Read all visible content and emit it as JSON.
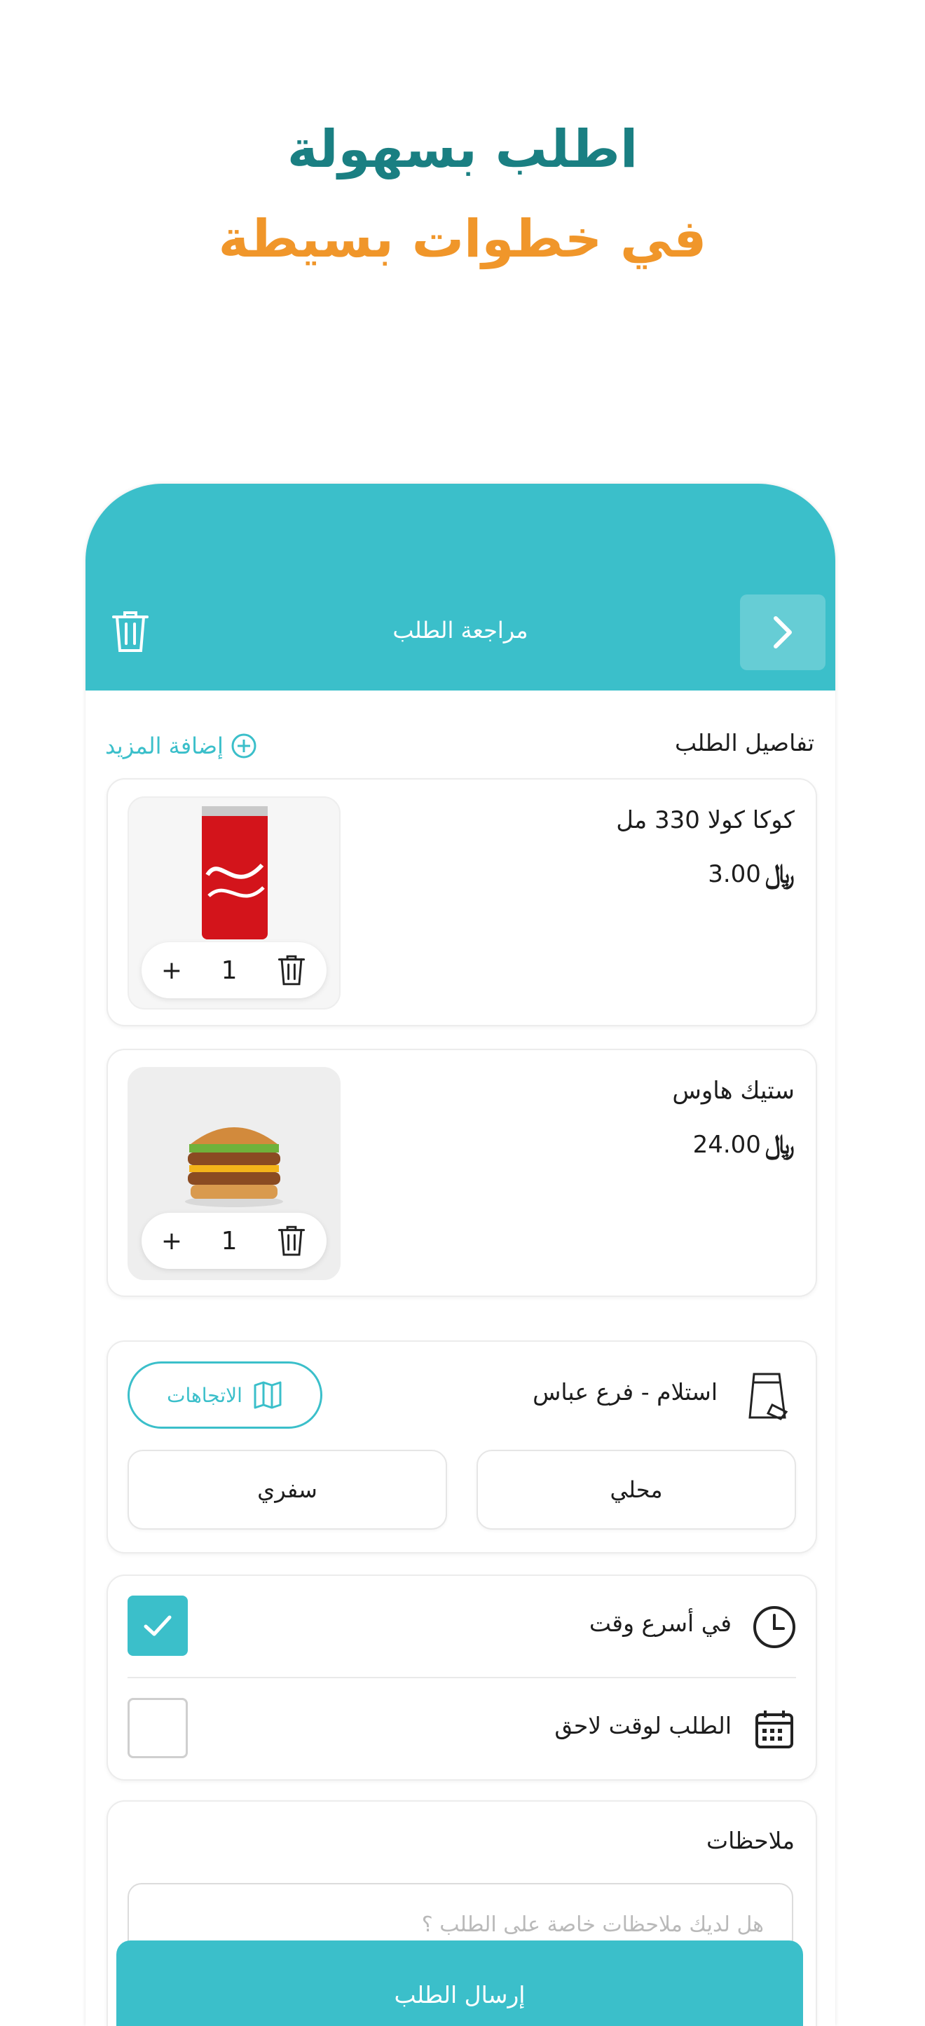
{
  "promo": {
    "headline_line1": "اطلب بسهولة",
    "headline_line2": "في خطوات بسيطة",
    "colors": {
      "line1": "#1a7f82",
      "line2": "#f0962a"
    }
  },
  "app_bar": {
    "title": "مراجعة الطلب",
    "back_icon": "chevron-right-icon",
    "clear_icon": "trash-icon",
    "color": "#3bbfca"
  },
  "order_details": {
    "section_title": "تفاصيل الطلب",
    "add_more_label": "إضافة المزيد",
    "items": [
      {
        "name": "كوكا كولا 330 مل",
        "price": "3.00",
        "quantity": "1",
        "image": "coca-cola-can"
      },
      {
        "name": "ستيك هاوس",
        "price": "24.00",
        "quantity": "1",
        "image": "burger"
      }
    ],
    "currency_symbol": "﷼"
  },
  "pickup": {
    "label": "استلام - فرع عباس",
    "directions_label": "الاتجاهات",
    "options": {
      "dine_in": "محلي",
      "takeaway": "سفري"
    }
  },
  "timing": {
    "asap_label": "في أسرع وقت",
    "asap_checked": true,
    "later_label": "الطلب لوقت لاحق",
    "later_checked": false
  },
  "notes": {
    "title": "ملاحظات",
    "placeholder": "هل لديك ملاحظات خاصة على الطلب ؟"
  },
  "submit": {
    "label": "إرسال الطلب"
  }
}
